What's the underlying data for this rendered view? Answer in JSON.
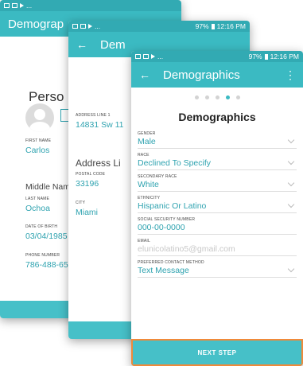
{
  "status_bar": {
    "battery": "97%",
    "time": "12:16 PM",
    "ellipsis": "..."
  },
  "colors": {
    "teal_header": "#3bbac2",
    "teal_status": "#32aab3",
    "teal_text": "#2fa3b0",
    "highlight": "#f08a3a"
  },
  "screen1": {
    "app_title": "Demograp",
    "section_title": "Perso",
    "fields": {
      "first_name_label": "FIRST NAME",
      "first_name_value": "Carlos",
      "middle_name_placeholder": "Middle Nam",
      "last_name_label": "LAST NAME",
      "last_name_value": "Ochoa",
      "dob_label": "DATE OF BIRTH",
      "dob_value": "03/04/1985",
      "phone_label": "PHONE NUMBER",
      "phone_value": "786-488-65"
    }
  },
  "screen2": {
    "app_title": "Dem",
    "fields": {
      "address1_label": "ADDRESS LINE 1",
      "address1_value": "14831 Sw 11",
      "address2_placeholder": "Address Li",
      "postal_label": "POSTAL CODE",
      "postal_value": "33196",
      "city_label": "CITY",
      "city_value": "Miami"
    }
  },
  "screen3": {
    "app_title": "Demographics",
    "heading": "Demographics",
    "progress": {
      "total_steps": 5,
      "current_step": 4
    },
    "fields": [
      {
        "label": "GENDER",
        "value": "Male",
        "dropdown": true
      },
      {
        "label": "RACE",
        "value": "Declined To Specify",
        "dropdown": true
      },
      {
        "label": "SECONDARY RACE",
        "value": "White",
        "dropdown": true
      },
      {
        "label": "ETHNICITY",
        "value": "Hispanic Or Latino",
        "dropdown": true
      },
      {
        "label": "SOCIAL SECURITY NUMBER",
        "value": "000-00-0000",
        "dropdown": false
      },
      {
        "label": "EMAIL",
        "value": "elunicolatino5@gmail.com",
        "dropdown": false,
        "placeholder": true
      },
      {
        "label": "PREFERRED CONTACT METHOD",
        "value": "Text Message",
        "dropdown": true
      }
    ],
    "next_button": "NEXT STEP"
  }
}
